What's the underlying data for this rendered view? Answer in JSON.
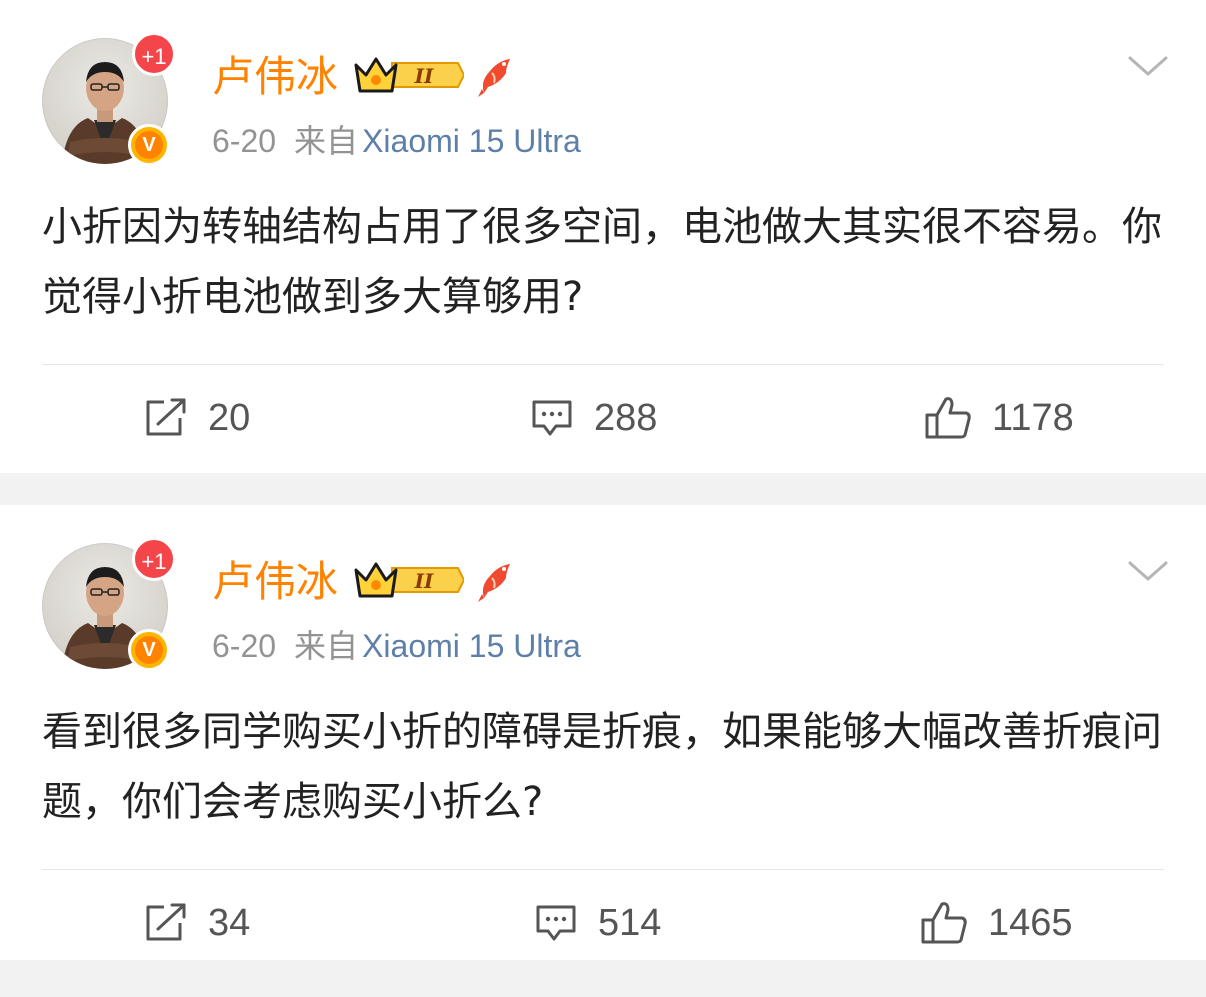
{
  "posts": [
    {
      "user": {
        "name": "卢伟冰",
        "notification_badge": "+1",
        "verified_badge": "V",
        "member_level": "II"
      },
      "date": "6-20",
      "source_prefix": "来自",
      "device": "Xiaomi 15 Ultra",
      "text": "小折因为转轴结构占用了很多空间，电池做大其实很不容易。你觉得小折电池做到多大算够用?",
      "stats": {
        "reposts": "20",
        "comments": "288",
        "likes": "1178"
      }
    },
    {
      "user": {
        "name": "卢伟冰",
        "notification_badge": "+1",
        "verified_badge": "V",
        "member_level": "II"
      },
      "date": "6-20",
      "source_prefix": "来自",
      "device": "Xiaomi 15 Ultra",
      "text": "看到很多同学购买小折的障碍是折痕，如果能够大幅改善折痕问题，你们会考虑购买小折么?",
      "stats": {
        "reposts": "34",
        "comments": "514",
        "likes": "1465"
      }
    }
  ],
  "colors": {
    "username": "#ff8200",
    "device_link": "#5d7fa8",
    "meta": "#939393",
    "badge_red": "#f4454a",
    "verified_orange": "#ff8200",
    "page_bg": "#f2f2f2"
  },
  "icons": {
    "repost": "repost-icon",
    "comment": "comment-icon",
    "like": "like-icon",
    "more": "chevron-down-icon"
  }
}
